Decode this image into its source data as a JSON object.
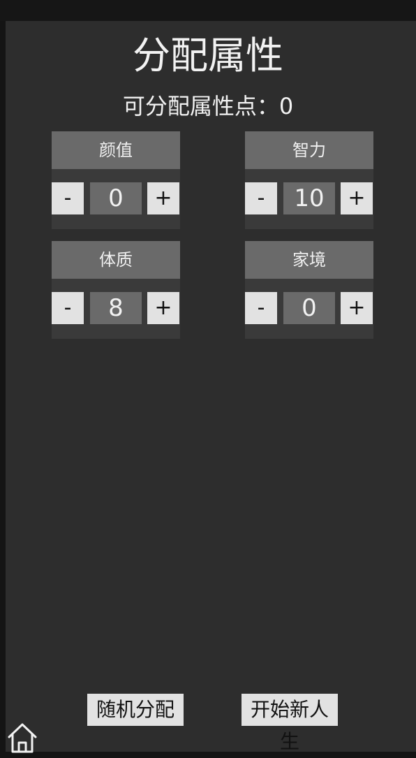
{
  "page": {
    "title": "分配属性",
    "points_label": "可分配属性点：",
    "points_value": "0"
  },
  "attributes": [
    {
      "label": "颜值",
      "value": "0"
    },
    {
      "label": "智力",
      "value": "10"
    },
    {
      "label": "体质",
      "value": "8"
    },
    {
      "label": "家境",
      "value": "0"
    }
  ],
  "controls": {
    "minus_label": "-",
    "plus_label": "+"
  },
  "actions": {
    "random_label": "随机分配",
    "start_label": "开始新人生"
  },
  "icons": {
    "home": "home-icon"
  },
  "colors": {
    "background": "#2d2d2d",
    "card": "#3a3a3a",
    "header": "#6a6a6a",
    "button": "#e2e2e2",
    "text": "#f2f2f2"
  }
}
